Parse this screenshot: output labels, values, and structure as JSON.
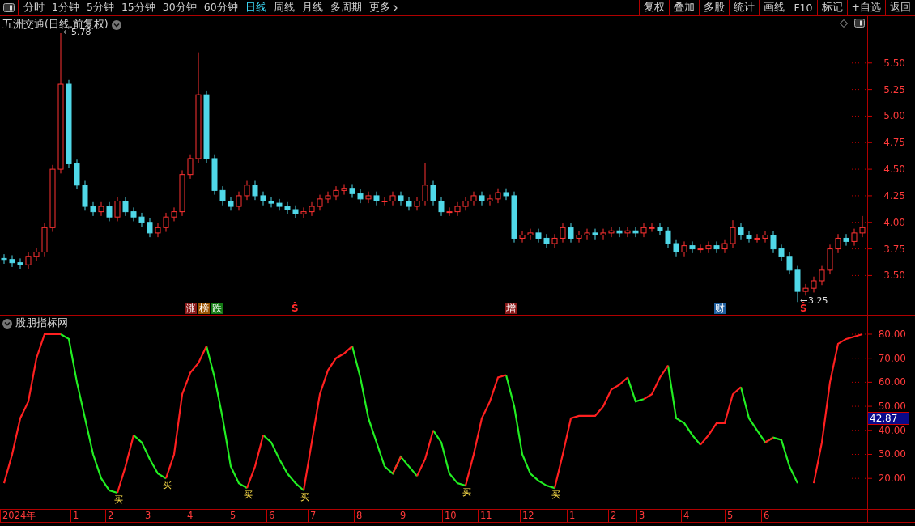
{
  "toolbar": {
    "periods": [
      {
        "label": "分时",
        "selected": false
      },
      {
        "label": "1分钟",
        "selected": false
      },
      {
        "label": "5分钟",
        "selected": false
      },
      {
        "label": "15分钟",
        "selected": false
      },
      {
        "label": "30分钟",
        "selected": false
      },
      {
        "label": "60分钟",
        "selected": false
      },
      {
        "label": "日线",
        "selected": true
      },
      {
        "label": "周线",
        "selected": false
      },
      {
        "label": "月线",
        "selected": false
      },
      {
        "label": "多周期",
        "selected": false
      },
      {
        "label": "更多",
        "selected": false
      }
    ],
    "buttons": [
      "复权",
      "叠加",
      "多股",
      "统计",
      "画线",
      "F10",
      "标记",
      "+自选",
      "返回"
    ]
  },
  "price_pane": {
    "title": "五洲交通(日线.前复权)",
    "event_marks": [
      {
        "text": "涨",
        "kind": "badge",
        "color": "#8b1a1a"
      },
      {
        "text": "榜",
        "kind": "badge",
        "color": "#9a5200"
      },
      {
        "text": "跌",
        "kind": "badge",
        "color": "#137a13"
      },
      {
        "text": "Ŝ",
        "kind": "glyph",
        "color": "#ff2a2a"
      },
      {
        "text": "增",
        "kind": "badge",
        "color": "#8b1a1a"
      },
      {
        "text": "财",
        "kind": "badge",
        "color": "#1f5f9f"
      },
      {
        "text": "Ŝ",
        "kind": "glyph",
        "color": "#ff2a2a"
      }
    ],
    "chart_data": {
      "type": "candlestick",
      "ylim": [
        3.13,
        5.94
      ],
      "yticks": [
        {
          "value": 3.5,
          "label": "3.50"
        },
        {
          "value": 3.75,
          "label": "3.75"
        },
        {
          "value": 4.0,
          "label": "4.00"
        },
        {
          "value": 4.25,
          "label": "4.25"
        },
        {
          "value": 4.5,
          "label": "4.50"
        },
        {
          "value": 4.75,
          "label": "4.75"
        },
        {
          "value": 5.0,
          "label": "5.00"
        },
        {
          "value": 5.25,
          "label": "5.25"
        },
        {
          "value": 5.5,
          "label": "5.50"
        }
      ],
      "ohlc": [
        [
          3.66,
          3.7,
          3.61,
          3.65
        ],
        [
          3.65,
          3.69,
          3.58,
          3.62
        ],
        [
          3.62,
          3.66,
          3.56,
          3.6
        ],
        [
          3.6,
          3.72,
          3.56,
          3.68
        ],
        [
          3.68,
          3.76,
          3.64,
          3.72
        ],
        [
          3.72,
          3.99,
          3.68,
          3.95
        ],
        [
          3.95,
          4.54,
          3.91,
          4.5
        ],
        [
          4.5,
          5.78,
          4.46,
          5.3
        ],
        [
          5.3,
          5.34,
          4.51,
          4.55
        ],
        [
          4.55,
          4.59,
          4.31,
          4.35
        ],
        [
          4.35,
          4.39,
          4.11,
          4.15
        ],
        [
          4.15,
          4.19,
          4.06,
          4.1
        ],
        [
          4.1,
          4.19,
          4.06,
          4.15
        ],
        [
          4.15,
          4.19,
          4.01,
          4.05
        ],
        [
          4.05,
          4.24,
          4.01,
          4.2
        ],
        [
          4.2,
          4.24,
          4.06,
          4.1
        ],
        [
          4.1,
          4.14,
          4.01,
          4.05
        ],
        [
          4.05,
          4.09,
          3.96,
          4.0
        ],
        [
          4.0,
          4.04,
          3.86,
          3.9
        ],
        [
          3.9,
          3.99,
          3.86,
          3.95
        ],
        [
          3.95,
          4.09,
          3.91,
          4.05
        ],
        [
          4.05,
          4.14,
          4.01,
          4.1
        ],
        [
          4.1,
          4.49,
          4.06,
          4.45
        ],
        [
          4.45,
          4.64,
          4.41,
          4.6
        ],
        [
          4.6,
          5.6,
          4.56,
          5.2
        ],
        [
          5.2,
          5.24,
          4.56,
          4.6
        ],
        [
          4.6,
          4.64,
          4.26,
          4.3
        ],
        [
          4.3,
          4.34,
          4.16,
          4.2
        ],
        [
          4.2,
          4.24,
          4.11,
          4.15
        ],
        [
          4.15,
          4.29,
          4.11,
          4.25
        ],
        [
          4.25,
          4.39,
          4.21,
          4.35
        ],
        [
          4.35,
          4.39,
          4.21,
          4.25
        ],
        [
          4.25,
          4.29,
          4.16,
          4.2
        ],
        [
          4.2,
          4.24,
          4.14,
          4.18
        ],
        [
          4.18,
          4.22,
          4.11,
          4.15
        ],
        [
          4.15,
          4.19,
          4.08,
          4.12
        ],
        [
          4.12,
          4.16,
          4.04,
          4.08
        ],
        [
          4.08,
          4.14,
          4.04,
          4.1
        ],
        [
          4.1,
          4.19,
          4.06,
          4.15
        ],
        [
          4.15,
          4.26,
          4.11,
          4.22
        ],
        [
          4.22,
          4.29,
          4.18,
          4.25
        ],
        [
          4.25,
          4.34,
          4.21,
          4.3
        ],
        [
          4.3,
          4.36,
          4.26,
          4.32
        ],
        [
          4.32,
          4.36,
          4.23,
          4.27
        ],
        [
          4.27,
          4.31,
          4.18,
          4.22
        ],
        [
          4.22,
          4.29,
          4.18,
          4.25
        ],
        [
          4.25,
          4.29,
          4.16,
          4.2
        ],
        [
          4.2,
          4.24,
          4.16,
          4.2
        ],
        [
          4.2,
          4.29,
          4.16,
          4.25
        ],
        [
          4.25,
          4.29,
          4.16,
          4.2
        ],
        [
          4.2,
          4.24,
          4.11,
          4.15
        ],
        [
          4.15,
          4.24,
          4.11,
          4.2
        ],
        [
          4.2,
          4.56,
          4.16,
          4.35
        ],
        [
          4.35,
          4.39,
          4.16,
          4.2
        ],
        [
          4.2,
          4.24,
          4.06,
          4.1
        ],
        [
          4.1,
          4.14,
          4.06,
          4.1
        ],
        [
          4.1,
          4.19,
          4.06,
          4.15
        ],
        [
          4.15,
          4.24,
          4.11,
          4.2
        ],
        [
          4.2,
          4.29,
          4.16,
          4.25
        ],
        [
          4.25,
          4.29,
          4.16,
          4.2
        ],
        [
          4.2,
          4.26,
          4.16,
          4.22
        ],
        [
          4.22,
          4.32,
          4.18,
          4.28
        ],
        [
          4.28,
          4.32,
          4.21,
          4.25
        ],
        [
          4.25,
          4.29,
          3.81,
          3.85
        ],
        [
          3.85,
          3.92,
          3.81,
          3.88
        ],
        [
          3.88,
          3.94,
          3.84,
          3.9
        ],
        [
          3.9,
          3.94,
          3.81,
          3.85
        ],
        [
          3.85,
          3.89,
          3.76,
          3.8
        ],
        [
          3.8,
          3.89,
          3.76,
          3.85
        ],
        [
          3.85,
          3.99,
          3.81,
          3.95
        ],
        [
          3.95,
          3.99,
          3.81,
          3.85
        ],
        [
          3.85,
          3.92,
          3.81,
          3.88
        ],
        [
          3.88,
          3.94,
          3.84,
          3.9
        ],
        [
          3.9,
          3.94,
          3.84,
          3.88
        ],
        [
          3.88,
          3.94,
          3.84,
          3.9
        ],
        [
          3.9,
          3.96,
          3.86,
          3.92
        ],
        [
          3.92,
          3.96,
          3.86,
          3.9
        ],
        [
          3.9,
          3.96,
          3.86,
          3.92
        ],
        [
          3.92,
          3.96,
          3.86,
          3.9
        ],
        [
          3.9,
          3.99,
          3.86,
          3.95
        ],
        [
          3.95,
          3.99,
          3.91,
          3.95
        ],
        [
          3.95,
          3.99,
          3.88,
          3.92
        ],
        [
          3.92,
          3.96,
          3.76,
          3.8
        ],
        [
          3.8,
          3.84,
          3.68,
          3.72
        ],
        [
          3.72,
          3.82,
          3.68,
          3.78
        ],
        [
          3.78,
          3.82,
          3.71,
          3.75
        ],
        [
          3.75,
          3.79,
          3.71,
          3.75
        ],
        [
          3.75,
          3.82,
          3.71,
          3.78
        ],
        [
          3.78,
          3.82,
          3.71,
          3.75
        ],
        [
          3.75,
          3.84,
          3.71,
          3.8
        ],
        [
          3.8,
          4.02,
          3.76,
          3.95
        ],
        [
          3.95,
          3.99,
          3.84,
          3.88
        ],
        [
          3.88,
          3.92,
          3.81,
          3.85
        ],
        [
          3.85,
          3.89,
          3.81,
          3.85
        ],
        [
          3.85,
          3.92,
          3.81,
          3.88
        ],
        [
          3.88,
          3.92,
          3.71,
          3.75
        ],
        [
          3.75,
          3.79,
          3.64,
          3.68
        ],
        [
          3.68,
          3.72,
          3.51,
          3.55
        ],
        [
          3.55,
          3.59,
          3.25,
          3.35
        ],
        [
          3.35,
          3.42,
          3.31,
          3.38
        ],
        [
          3.38,
          3.49,
          3.34,
          3.45
        ],
        [
          3.45,
          3.59,
          3.41,
          3.55
        ],
        [
          3.55,
          3.79,
          3.51,
          3.75
        ],
        [
          3.75,
          3.89,
          3.71,
          3.85
        ],
        [
          3.85,
          3.89,
          3.78,
          3.82
        ],
        [
          3.82,
          3.94,
          3.78,
          3.9
        ],
        [
          3.9,
          4.06,
          3.86,
          3.95
        ]
      ],
      "annotations": [
        {
          "text": "5.78"
        },
        {
          "text": "3.25"
        }
      ]
    }
  },
  "indicator_pane": {
    "title": "股朋指标网",
    "current_value": "42.87",
    "chart_data": {
      "type": "line",
      "ylim": [
        7.27,
        87.74
      ],
      "yticks": [
        {
          "value": 20,
          "label": "20.00"
        },
        {
          "value": 30,
          "label": "30.00"
        },
        {
          "value": 40,
          "label": "40.00"
        },
        {
          "value": 50,
          "label": "50.00"
        },
        {
          "value": 60,
          "label": "60.00"
        },
        {
          "value": 70,
          "label": "70.00"
        },
        {
          "value": 80,
          "label": "80.00"
        }
      ],
      "series": [
        {
          "color": "#22ee22",
          "values": [
            null,
            null,
            null,
            null,
            null,
            null,
            null,
            80,
            78,
            60,
            45,
            30,
            20,
            15,
            14,
            null,
            38,
            35,
            28,
            22,
            20,
            null,
            null,
            null,
            null,
            75,
            62,
            45,
            25,
            18,
            16,
            null,
            38,
            35,
            28,
            22,
            18,
            15,
            null,
            null,
            null,
            null,
            null,
            75,
            62,
            45,
            35,
            25,
            22,
            29,
            25,
            21,
            null,
            40,
            35,
            22,
            18,
            17,
            null,
            null,
            null,
            null,
            63,
            50,
            30,
            22,
            19,
            17,
            16,
            null,
            null,
            null,
            null,
            null,
            null,
            null,
            null,
            62,
            52,
            53,
            null,
            null,
            67,
            45,
            43,
            38,
            34,
            null,
            null,
            null,
            null,
            58,
            45,
            40,
            35,
            37,
            36,
            25,
            18,
            null,
            null,
            null,
            null,
            null,
            null,
            null,
            null
          ]
        },
        {
          "color": "#ff2020",
          "values": [
            18,
            30,
            45,
            52,
            70,
            80,
            80,
            80,
            null,
            null,
            null,
            null,
            null,
            null,
            14,
            25,
            38,
            null,
            null,
            null,
            20,
            30,
            55,
            64,
            68,
            75,
            null,
            null,
            null,
            null,
            16,
            25,
            38,
            null,
            null,
            null,
            null,
            15,
            35,
            55,
            65,
            70,
            72,
            75,
            null,
            null,
            null,
            null,
            22,
            29,
            null,
            21,
            28,
            40,
            null,
            null,
            null,
            17,
            30,
            45,
            52,
            62,
            63,
            null,
            null,
            null,
            null,
            null,
            16,
            30,
            45,
            46,
            46,
            46,
            50,
            57,
            59,
            62,
            null,
            53,
            55,
            62,
            67,
            null,
            null,
            null,
            34,
            38,
            43,
            43,
            55,
            58,
            null,
            null,
            35,
            37,
            null,
            null,
            null,
            null,
            18,
            35,
            60,
            76,
            78,
            79,
            80
          ]
        }
      ],
      "annotations": [
        {
          "text": "买"
        },
        {
          "text": "买"
        },
        {
          "text": "买"
        },
        {
          "text": "买"
        },
        {
          "text": "买"
        },
        {
          "text": "买"
        }
      ]
    }
  },
  "date_axis": {
    "labels": [
      "2024年",
      "1",
      "2",
      "3",
      "4",
      "5",
      "6",
      "7",
      "8",
      "9",
      "10",
      "11",
      "12",
      "1",
      "2",
      "3",
      "4",
      "5",
      "6"
    ]
  }
}
